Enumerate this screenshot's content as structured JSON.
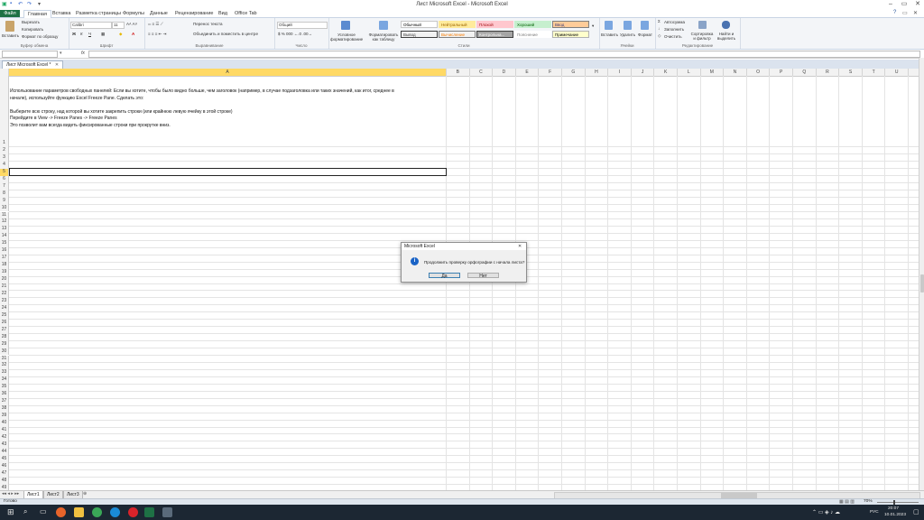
{
  "window": {
    "title": "Лист Microsoft Excel  -  Microsoft Excel",
    "minimize_glyph": "–",
    "maximize_glyph": "▭",
    "close_glyph": "✕"
  },
  "menu": {
    "file": "Файл",
    "tabs": [
      "Главная",
      "Вставка",
      "Разметка страницы",
      "Формулы",
      "Данные",
      "Рецензирование",
      "Вид",
      "Office Tab"
    ]
  },
  "ribbon": {
    "clipboard": {
      "paste": "Вставить",
      "cut": "Вырезать",
      "copy": "Копировать",
      "format_painter": "Формат по образцу",
      "label": "Буфер обмена"
    },
    "font": {
      "name": "Calibri",
      "size": "11",
      "bold": "Ж",
      "italic": "К",
      "underline": "Ч",
      "label": "Шрифт"
    },
    "alignment": {
      "wrap": "Перенос текста",
      "merge": "Объединить и поместить в центре",
      "label": "Выравнивание"
    },
    "number": {
      "format": "Общий",
      "label": "Число"
    },
    "styles": {
      "conditional": "Условное форматирование",
      "as_table": "Форматировать как таблицу",
      "label": "Стили",
      "cells": [
        {
          "text": "Обычный",
          "bg": "#ffffff",
          "fg": "#000000",
          "border": "#c6c6c6"
        },
        {
          "text": "Нейтральный",
          "bg": "#ffeb9c",
          "fg": "#9c6500",
          "border": "#ffeb9c"
        },
        {
          "text": "Плохой",
          "bg": "#ffc7ce",
          "fg": "#9c0006",
          "border": "#ffc7ce"
        },
        {
          "text": "Хороший",
          "bg": "#c6efce",
          "fg": "#006100",
          "border": "#c6efce"
        },
        {
          "text": "Ввод",
          "bg": "#ffcc99",
          "fg": "#3f3f76",
          "border": "#7f7f7f"
        },
        {
          "text": "Вывод",
          "bg": "#f2f2f2",
          "fg": "#3f3f3f",
          "border": "#3f3f3f"
        },
        {
          "text": "Вычисление",
          "bg": "#f2f2f2",
          "fg": "#fa7d00",
          "border": "#7f7f7f"
        },
        {
          "text": "Контрольна...",
          "bg": "#a5a5a5",
          "fg": "#ffffff",
          "border": "#3f3f3f"
        },
        {
          "text": "Пояснение",
          "bg": "#ffffff",
          "fg": "#7f7f7f",
          "border": "#ffffff"
        },
        {
          "text": "Примечание",
          "bg": "#ffffcc",
          "fg": "#000000",
          "border": "#b2b2b2"
        }
      ]
    },
    "cells_group": {
      "insert": "Вставить",
      "delete": "Удалить",
      "format": "Формат",
      "label": "Ячейки"
    },
    "editing": {
      "autosum": "Автосумма",
      "fill": "Заполнить",
      "clear": "Очистить",
      "sort": "Сортировка и фильтр",
      "find": "Найти и выделить",
      "label": "Редактирование"
    }
  },
  "formula_bar": {
    "fx": "fx",
    "name": "",
    "value": ""
  },
  "workbook_tab": {
    "title": "Лист Microsoft Excel *"
  },
  "sheet": {
    "columns": [
      "A",
      "B",
      "C",
      "D",
      "E",
      "F",
      "G",
      "H",
      "I",
      "J",
      "K",
      "L",
      "M",
      "N",
      "O",
      "P",
      "Q",
      "R",
      "S",
      "T",
      "U"
    ],
    "selected_column": "A",
    "rows": [
      "1",
      "2",
      "3",
      "4",
      "5",
      "6",
      "7",
      "8",
      "9",
      "10",
      "11",
      "12",
      "13",
      "14",
      "15",
      "16",
      "17",
      "18",
      "19",
      "20",
      "21",
      "22",
      "23",
      "24",
      "25",
      "26",
      "27",
      "28",
      "29",
      "30",
      "31",
      "32",
      "33",
      "34",
      "35",
      "36",
      "37",
      "38",
      "39",
      "40",
      "41",
      "42",
      "43",
      "44",
      "45",
      "46",
      "47",
      "48",
      "49"
    ],
    "selected_row": "5",
    "cell_text_lines": [
      "Использование параметров свободных панелей: Если вы хотите, чтобы было видно больше, чем заголовок (например, в случае подзаголовка или таких значений, как итог, среднее в",
      "начале), используйте функцию Excel Freeze Pane. Сделать это:",
      "",
      "    Выберите всю строку, над которой вы хотите закрепить строки (или крайнюю левую ячейку в этой строке)",
      "    Перейдите в View -> Freeze Panes -> Freeze Panes",
      "    Это позволит вам всегда видеть фиксированные строки при прокрутке вниз."
    ]
  },
  "sheet_tabs": [
    "Лист1",
    "Лист2",
    "Лист3"
  ],
  "status": {
    "ready": "Готово",
    "zoom": "70%"
  },
  "dialog": {
    "title": "Microsoft Excel",
    "message": "Продолжить проверку орфографии с начала листа?",
    "yes": "Да",
    "no": "Нет"
  },
  "taskbar": {
    "lang": "РУС",
    "time": "20:07",
    "date": "10.01.2023"
  }
}
